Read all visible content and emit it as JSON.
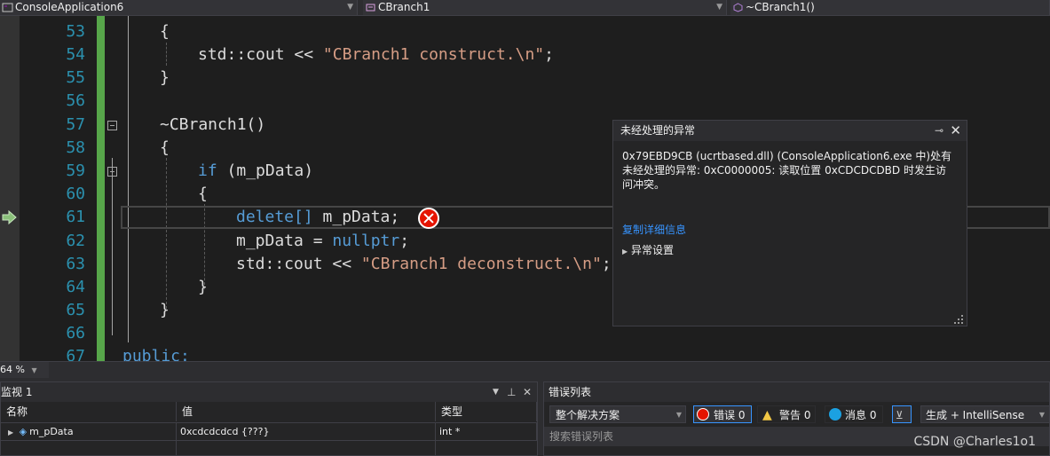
{
  "navbar": {
    "project": "ConsoleApplication6",
    "class": "CBranch1",
    "member": "~CBranch1()"
  },
  "editor": {
    "line_numbers": [
      "53",
      "54",
      "55",
      "56",
      "57",
      "58",
      "59",
      "60",
      "61",
      "62",
      "63",
      "64",
      "65",
      "66",
      "67"
    ],
    "lines": {
      "l53": "{",
      "l54_a": "std::cout << ",
      "l54_str": "\"CBranch1 construct.\\n\"",
      "l54_b": ";",
      "l55": "}",
      "l57": "~CBranch1()",
      "l58": "{",
      "l59_kw": "if",
      "l59_b": " (m_pData)",
      "l60": "{",
      "l61_kw": "delete[]",
      "l61_b": " m_pData;",
      "l62_a": "m_pData = ",
      "l62_kw": "nullptr",
      "l62_b": ";",
      "l63_a": "std::cout << ",
      "l63_str": "\"CBranch1 deconstruct.\\n\"",
      "l63_b": ";",
      "l64": "}",
      "l65": "}",
      "l67": "public:"
    }
  },
  "exception": {
    "title": "未经处理的异常",
    "message": "0x79EBD9CB (ucrtbased.dll) (ConsoleApplication6.exe 中)处有未经处理的异常: 0xC0000005: 读取位置 0xCDCDCDBD 时发生访问冲突。",
    "copy_link": "复制详细信息",
    "settings": "异常设置"
  },
  "zoom": "64 %",
  "watch": {
    "title": "监视 1",
    "columns": [
      "名称",
      "值",
      "类型"
    ],
    "rows": [
      {
        "name": "m_pData",
        "value": "0xcdcdcdcd {???}",
        "type": "int *"
      }
    ]
  },
  "error_list": {
    "title": "错误列表",
    "scope": "整个解决方案",
    "errors": "错误 0",
    "warnings": "警告 0",
    "messages": "消息 0",
    "build_filter": "生成 + IntelliSense",
    "search_placeholder": "搜索错误列表"
  },
  "watermark": "CSDN @Charles1o1",
  "colors": {
    "keyword": "#569cd6",
    "string": "#d69d85",
    "line_number": "#2b91af",
    "change_bar": "#57a64a",
    "error_red": "#e51400",
    "link": "#3794ff"
  }
}
